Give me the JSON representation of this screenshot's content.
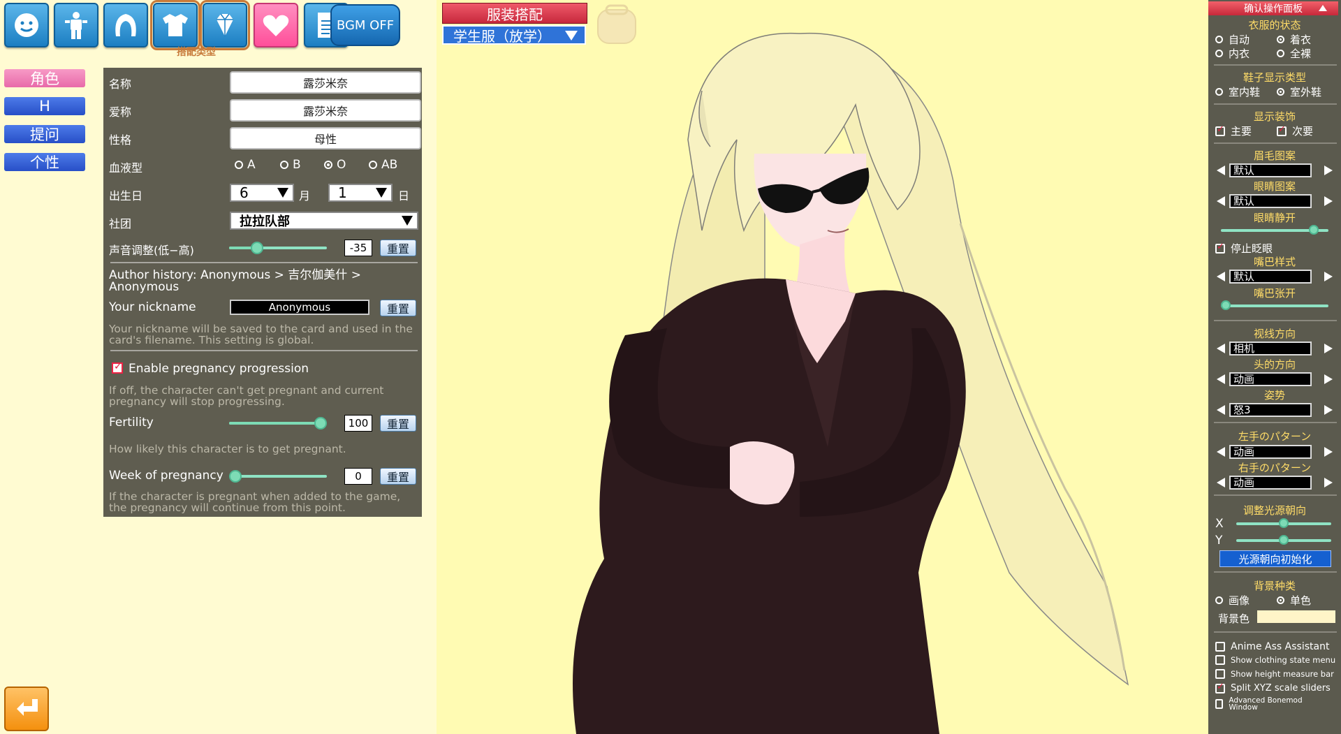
{
  "toolbar": {
    "icons": [
      "face-icon",
      "body-icon",
      "hair-icon",
      "clothes-icon",
      "accessory-icon",
      "heart-icon",
      "document-icon"
    ],
    "bgm_label": "BGM OFF",
    "active_tip": "搭配类型"
  },
  "left_tabs": [
    {
      "label": "角色",
      "active": true
    },
    {
      "label": "H",
      "active": false
    },
    {
      "label": "提问",
      "active": false
    },
    {
      "label": "个性",
      "active": false
    }
  ],
  "panel": {
    "name_label": "名称",
    "name_value": "露莎米奈",
    "nickname_label": "爱称",
    "nickname_value": "露莎米奈",
    "personality_label": "性格",
    "personality_value": "母性",
    "blood_label": "血液型",
    "blood_options": [
      "A",
      "B",
      "O",
      "AB"
    ],
    "blood_selected": "O",
    "birthday_label": "出生日",
    "birth_month": "6",
    "month_unit": "月",
    "birth_day": "1",
    "day_unit": "日",
    "club_label": "社团",
    "club_value": "拉拉队部",
    "voice_label": "声音调整(低−高)",
    "voice_value": "-35",
    "voice_level": 0.25,
    "reset_label": "重置",
    "author_history": "Author history: Anonymous > 吉尔伽美什 > Anonymous",
    "your_nickname_label": "Your nickname",
    "your_nickname_value": "Anonymous",
    "nickname_help": "Your nickname will be saved to the card and used in the card's filename. This setting is global.",
    "pregnancy_label": "Enable pregnancy progression",
    "pregnancy_enabled": true,
    "pregnancy_help": "If off, the character can't get pregnant and current pregnancy will stop progressing.",
    "fertility_label": "Fertility",
    "fertility_value": "100",
    "fertility_level": 1.0,
    "fertility_help": "How likely this character is to get pregnant.",
    "week_label": "Week of pregnancy",
    "week_value": "0",
    "week_level": 0.0,
    "week_help": "If the character is pregnant when added to the game, the pregnancy will continue from this point."
  },
  "outfit": {
    "title": "服装搭配",
    "selected": "学生服（放学）"
  },
  "right_panel": {
    "header": "确认操作面板",
    "clothes_state_title": "衣服的状态",
    "clothes_state_options": [
      "自动",
      "着衣",
      "内衣",
      "全裸"
    ],
    "clothes_state_selected": "着衣",
    "shoes_title": "鞋子显示类型",
    "shoes_options": [
      "室内鞋",
      "室外鞋"
    ],
    "shoes_selected": "室外鞋",
    "accessory_title": "显示装饰",
    "accessory_main": "主要",
    "accessory_sub": "次要",
    "eyebrow_title": "眉毛图案",
    "eyebrow_value": "默认",
    "eye_title": "眼睛图案",
    "eye_value": "默认",
    "eye_open_title": "眼睛静开",
    "eye_open_level": 0.9,
    "stop_blink": "停止眨眼",
    "mouth_title": "嘴巴样式",
    "mouth_value": "默认",
    "mouth_open_title": "嘴巴张开",
    "mouth_open_level": 0.0,
    "gaze_title": "视线方向",
    "gaze_value": "相机",
    "head_title": "头的方向",
    "head_value": "动画",
    "pose_title": "姿势",
    "pose_value": "怒3",
    "left_hand_title": "左手のパターン",
    "left_hand_value": "动画",
    "right_hand_title": "右手のパターン",
    "right_hand_value": "动画",
    "light_title": "调整光源朝向",
    "light_x_label": "X",
    "light_y_label": "Y",
    "light_x_level": 0.5,
    "light_y_level": 0.5,
    "light_reset": "光源朝向初始化",
    "bg_title": "背景种类",
    "bg_options": [
      "画像",
      "单色"
    ],
    "bg_selected": "单色",
    "bg_color_label": "背景色",
    "bg_color": "#fff5c8",
    "checkboxes": [
      {
        "label": "Anime Ass Assistant",
        "checked": false
      },
      {
        "label": "Show clothing state menu",
        "checked": false
      },
      {
        "label": "Show height measure bar",
        "checked": false
      },
      {
        "label": "Split XYZ scale sliders",
        "checked": true
      },
      {
        "label": "Advanced Bonemod Window",
        "checked": false
      }
    ]
  },
  "colors": {
    "accent_blue": "#2f73d8",
    "accent_pink": "#e86aa9",
    "accent_red": "#c7283c",
    "panel_bg": "#5f5d50",
    "viewport_bg": "#fffbb3",
    "slider": "#7ddbb5",
    "section_title": "#ffdc68"
  }
}
